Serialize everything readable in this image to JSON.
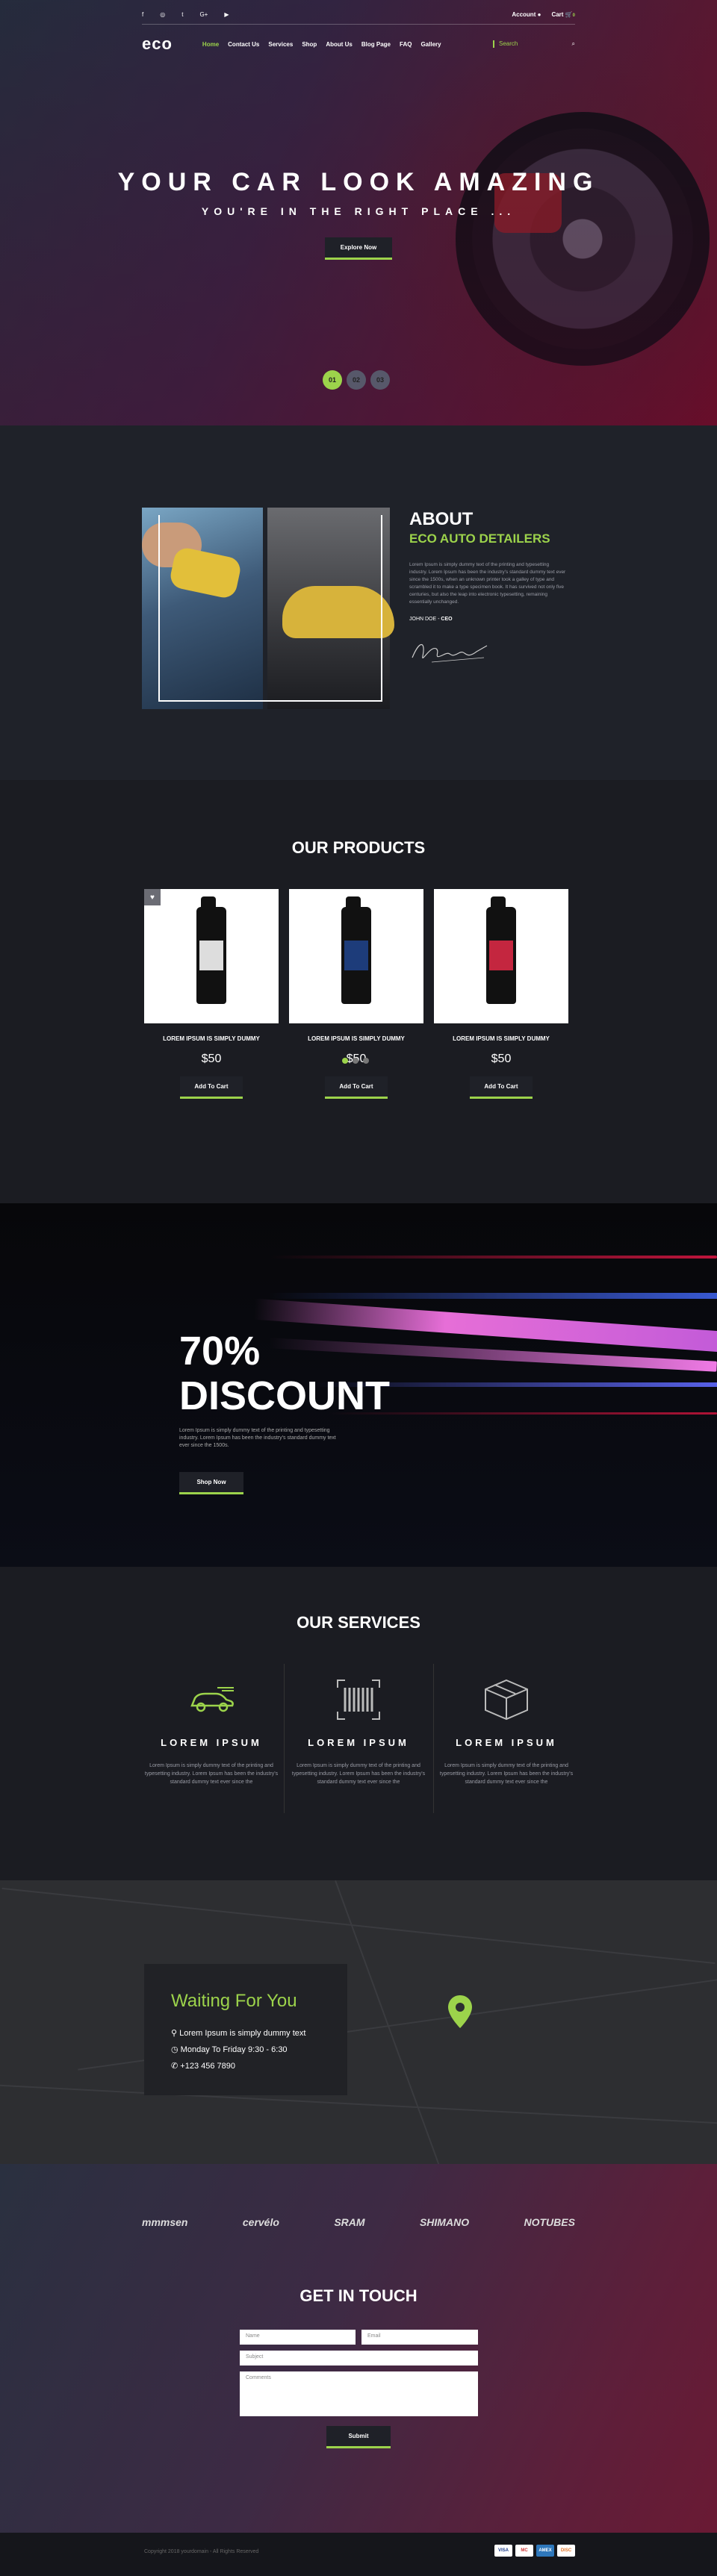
{
  "topbar": {
    "socials": [
      "f",
      "◎",
      "t",
      "G+",
      "▶"
    ],
    "account_label": "Account",
    "cart_label": "Cart",
    "cart_count": "0"
  },
  "nav": {
    "logo": "eco",
    "items": [
      "Home",
      "Contact Us",
      "Services",
      "Shop",
      "About Us",
      "Blog Page",
      "FAQ",
      "Gallery"
    ],
    "search_placeholder": "Search"
  },
  "hero": {
    "title": "YOUR CAR LOOK AMAZING",
    "subtitle": "YOU'RE IN THE RIGHT PLACE ...",
    "button": "Explore Now",
    "slides": [
      "01",
      "02",
      "03"
    ]
  },
  "about": {
    "title": "ABOUT",
    "subtitle": "ECO AUTO DETAILERS",
    "text": "Lorem Ipsum is simply dummy text of the printing and typesetting industry. Lorem Ipsum has been the industry's standard dummy text ever since the 1500s, when an unknown printer took a galley of type and scrambled it to make a type specimen book. It has survived not only five centuries, but also the leap into electronic typesetting, remaining essentially unchanged.",
    "author_name": "JOHN DOE -",
    "author_role": "CEO"
  },
  "products": {
    "title": "OUR PRODUCTS",
    "items": [
      {
        "name": "LOREM IPSUM IS SIMPLY DUMMY",
        "price": "$50",
        "button": "Add To Cart"
      },
      {
        "name": "LOREM IPSUM IS SIMPLY DUMMY",
        "price": "$50",
        "button": "Add To Cart"
      },
      {
        "name": "LOREM IPSUM IS SIMPLY DUMMY",
        "price": "$50",
        "button": "Add To Cart"
      }
    ]
  },
  "discount": {
    "line1": "70%",
    "line2": "DISCOUNT",
    "text": "Lorem Ipsum is simply dummy text of the printing and typesetting industry. Lorem Ipsum has been the industry's standard dummy text ever since the 1500s.",
    "button": "Shop Now"
  },
  "services": {
    "title": "OUR SERVICES",
    "items": [
      {
        "icon": "car-icon",
        "title": "LOREM IPSUM",
        "text": "Lorem Ipsum is simply dummy text of the printing and typesetting industry. Lorem Ipsum has been the industry's standard dummy text ever since the"
      },
      {
        "icon": "barcode-icon",
        "title": "LOREM IPSUM",
        "text": "Lorem Ipsum is simply dummy text of the printing and typesetting industry. Lorem Ipsum has been the industry's standard dummy text ever since the"
      },
      {
        "icon": "box-icon",
        "title": "LOREM IPSUM",
        "text": "Lorem Ipsum is simply dummy text of the printing and typesetting industry. Lorem Ipsum has been the industry's standard dummy text ever since the"
      }
    ]
  },
  "map": {
    "title": "Waiting For You",
    "address": "Lorem Ipsum is simply dummy text",
    "hours": "Monday To Friday 9:30 - 6:30",
    "phone": "+123 456 7890"
  },
  "brands": [
    "mmmsen",
    "cervélo",
    "SRAM",
    "SHIMANO",
    "NOTUBES"
  ],
  "contact": {
    "title": "GET IN TOUCH",
    "name_placeholder": "Name",
    "email_placeholder": "Email",
    "subject_placeholder": "Subject",
    "comments_placeholder": "Comments",
    "submit": "Submit"
  },
  "footer": {
    "copyright": "Copyright 2018 yourdomain - All Rights Reserved",
    "payments": [
      "VISA",
      "MC",
      "AMEX",
      "DISC"
    ]
  },
  "colors": {
    "accent": "#9cd34b",
    "bg": "#1b1c22"
  }
}
